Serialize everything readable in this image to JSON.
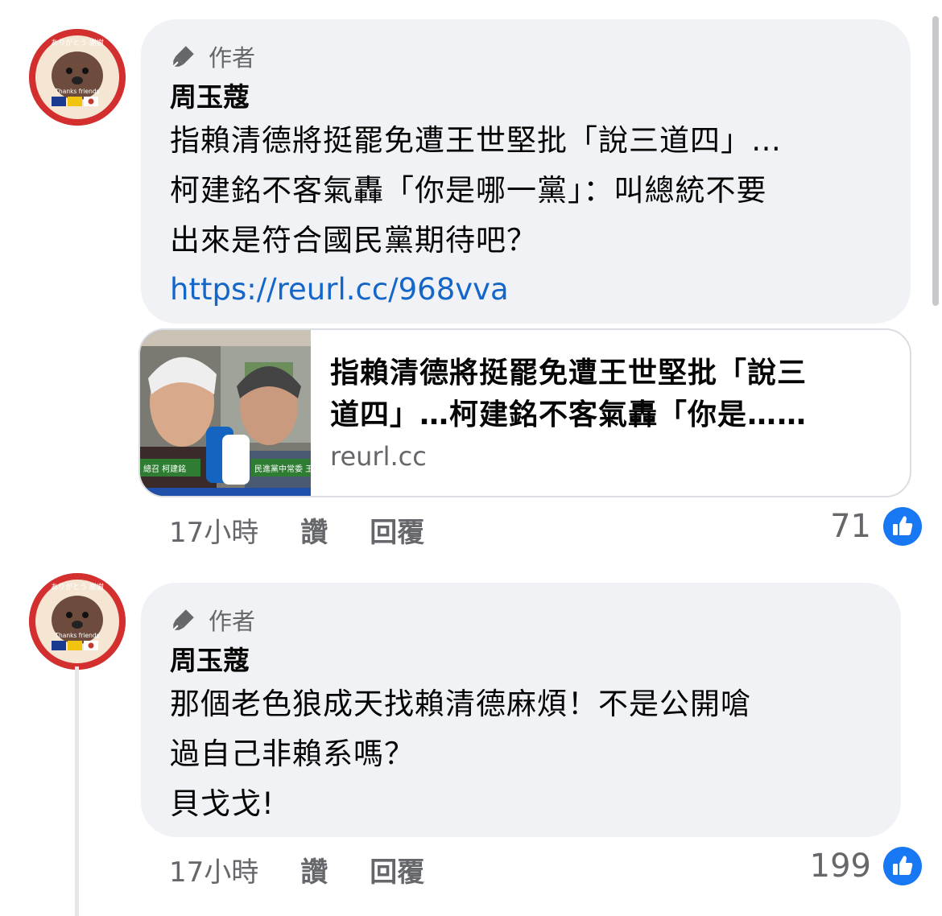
{
  "comments": [
    {
      "author_badge": "作者",
      "name": "周玉蔻",
      "text": "指賴清德將挺罷免遭王世堅批「說三道四」…\n柯建銘不客氣轟「你是哪一黨」：叫總統不要\n出來是符合國民黨期待吧？",
      "link": "https://reurl.cc/968vva",
      "preview": {
        "title": "指賴清德將挺罷免遭王世堅批「說三\n道四」…柯建銘不客氣轟「你是……",
        "domain": "reurl.cc",
        "caption_left": "總召 柯建銘",
        "caption_right": "民進黨中常委 王"
      },
      "time": "17小時",
      "like_label": "讚",
      "reply_label": "回覆",
      "likes": "71"
    },
    {
      "author_badge": "作者",
      "name": "周玉蔻",
      "text": "那個老色狼成天找賴清德麻煩！不是公開嗆\n過自己非賴系嗎？\n貝戈戈!",
      "time": "17小時",
      "like_label": "讚",
      "reply_label": "回覆",
      "likes": "199"
    }
  ],
  "avatar": {
    "text_top": "ありがとう 謝謝",
    "text_bottom": "Thanks friends"
  },
  "colors": {
    "link": "#1467c9",
    "like_blue": "#1877f2",
    "bubble": "#f0f2f5",
    "meta": "#65676b"
  },
  "icons": {
    "badge": "microphone-pen-icon",
    "like": "thumbs-up-icon"
  }
}
